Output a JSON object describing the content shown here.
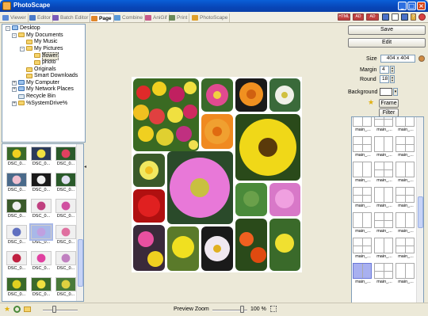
{
  "window": {
    "title": "PhotoScape"
  },
  "tabs": [
    {
      "label": "Viewer",
      "color": "#5a8ad8"
    },
    {
      "label": "Editor",
      "color": "#4a7ac8"
    },
    {
      "label": "Batch Editor",
      "color": "#7a5ab8"
    },
    {
      "label": "Page",
      "color": "#e0862a"
    },
    {
      "label": "Combine",
      "color": "#5a9ad8"
    },
    {
      "label": "AniGif",
      "color": "#c85a8a"
    },
    {
      "label": "Print",
      "color": "#6a8a5a"
    },
    {
      "label": "PhotoScape",
      "color": "#e0a02a"
    }
  ],
  "active_tab": "Page",
  "tree": [
    {
      "label": "Desktop",
      "icon": "desktop-icon",
      "expander": "-"
    },
    {
      "label": "My Documents",
      "icon": "folder-icon",
      "expander": "-"
    },
    {
      "label": "My Music",
      "icon": "folder-icon",
      "expander": ""
    },
    {
      "label": "My Pictures",
      "icon": "folder-icon",
      "expander": "-"
    },
    {
      "label": "flower",
      "icon": "folder-open-icon",
      "expander": "",
      "selected": true
    },
    {
      "label": "photo",
      "icon": "folder-icon",
      "expander": ""
    },
    {
      "label": "Originals",
      "icon": "folder-icon",
      "expander": ""
    },
    {
      "label": "Smart Downloads",
      "icon": "folder-icon",
      "expander": ""
    },
    {
      "label": "My Computer",
      "icon": "computer-icon",
      "expander": "+"
    },
    {
      "label": "My Network Places",
      "icon": "network-icon",
      "expander": "+"
    },
    {
      "label": "Recycle Bin",
      "icon": "recycle-bin-icon",
      "expander": ""
    },
    {
      "label": "%SystemDrive%",
      "icon": "folder-icon",
      "expander": "+"
    }
  ],
  "thumbnails": [
    {
      "label": "DSC_0...",
      "colors": [
        "#3a6a2a",
        "#f0d020"
      ]
    },
    {
      "label": "DSC_0...",
      "colors": [
        "#2a3a5a",
        "#f0e040"
      ]
    },
    {
      "label": "DSC_0...",
      "colors": [
        "#2a5a2a",
        "#e04060"
      ]
    },
    {
      "label": "DSC_0...",
      "colors": [
        "#4a6a8a",
        "#f0c0d0"
      ]
    },
    {
      "label": "DSC_0...",
      "colors": [
        "#1a1a1a",
        "#f0f0f0"
      ]
    },
    {
      "label": "DSC_0...",
      "colors": [
        "#2a5a2a",
        "#e0e0f0"
      ]
    },
    {
      "label": "DSC_0...",
      "colors": [
        "#3a5a2a",
        "#f0f0f0"
      ]
    },
    {
      "label": "DSC_0...",
      "colors": [
        "#f0f0f0",
        "#c04080"
      ]
    },
    {
      "label": "DSC_0...",
      "colors": [
        "#f0f0f0",
        "#d050a0"
      ]
    },
    {
      "label": "DSC_0...",
      "colors": [
        "#f0f0f0",
        "#6070c0"
      ]
    },
    {
      "label": "DSC_0...",
      "colors": [
        "#a8b8e8",
        "#c0a0e0"
      ],
      "selected": true
    },
    {
      "label": "DSC_0...",
      "colors": [
        "#f0f0f0",
        "#e070a0"
      ]
    },
    {
      "label": "DSC_0...",
      "colors": [
        "#f0f0f0",
        "#c02040"
      ]
    },
    {
      "label": "DSC_0...",
      "colors": [
        "#f0f0f0",
        "#e040a0"
      ]
    },
    {
      "label": "DSC_0...",
      "colors": [
        "#f0f0f0",
        "#c080c0"
      ]
    },
    {
      "label": "DSC_0...",
      "colors": [
        "#3a6a2a",
        "#e0d020"
      ]
    },
    {
      "label": "DSC_0...",
      "colors": [
        "#3a6a2a",
        "#f0e040"
      ]
    },
    {
      "label": "DSC_0...",
      "colors": [
        "#4a7a3a",
        "#e0d040"
      ]
    }
  ],
  "right_panel": {
    "save_label": "Save",
    "edit_label": "Edit",
    "size_label": "Size",
    "size_value": "404 x 404",
    "margin_label": "Margin",
    "margin_value": "4",
    "round_label": "Round",
    "round_value": "18",
    "background_label": "Background",
    "frame_label": "Frame",
    "filter_label": "Filter"
  },
  "templates": [
    "main_...",
    "main_...",
    "main_...",
    "main_...",
    "main_...",
    "main_...",
    "main_...",
    "main_...",
    "main_...",
    "main_...",
    "main_...",
    "main_...",
    "main_...",
    "main_...",
    "main_...",
    "main_...",
    "main_...",
    "main_...",
    "main_...",
    "main_...",
    "main_..."
  ],
  "status": {
    "preview_zoom_label": "Preview Zoom",
    "zoom_value": "100 %"
  },
  "colors": {
    "titlebar": "#0846b8",
    "panel_bg": "#ece9d8",
    "selection": "#a8b8e8"
  }
}
